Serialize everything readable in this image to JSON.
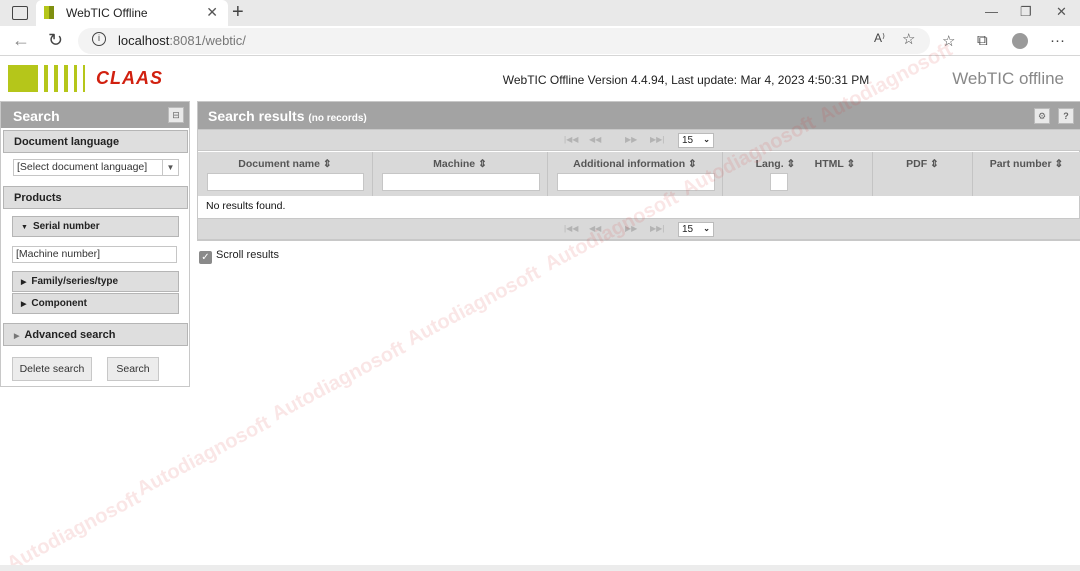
{
  "browser": {
    "tab_title": "WebTIC Offline",
    "url_host": "localhost",
    "url_rest": ":8081/webtic/"
  },
  "header": {
    "brand_logo": "CLAAS",
    "version_text": "WebTIC Offline Version 4.4.94, Last update: Mar 4, 2023 4:50:31 PM",
    "product_name": "WebTIC offline"
  },
  "search": {
    "title": "Search",
    "document_language": {
      "label": "Document language",
      "placeholder": "[Select document language]"
    },
    "products": {
      "label": "Products",
      "serial_number": "Serial number",
      "machine_number_placeholder": "[Machine number]",
      "family_series_type": "Family/series/type",
      "component": "Component"
    },
    "advanced_search": "Advanced search",
    "delete_button": "Delete search",
    "search_button": "Search"
  },
  "results": {
    "title": "Search results",
    "records_note": "(no records)",
    "page_size": "15",
    "columns": [
      "Document name",
      "Machine",
      "Additional information",
      "Lang.",
      "HTML",
      "PDF",
      "Part number"
    ],
    "empty_message": "No results found.",
    "scroll_label": "Scroll results"
  },
  "watermark": "Autodiagnosoft",
  "colors": {
    "panel_header": "#a3a3a3",
    "claas_red": "#d1200f",
    "claas_green": "#b5c61a"
  }
}
